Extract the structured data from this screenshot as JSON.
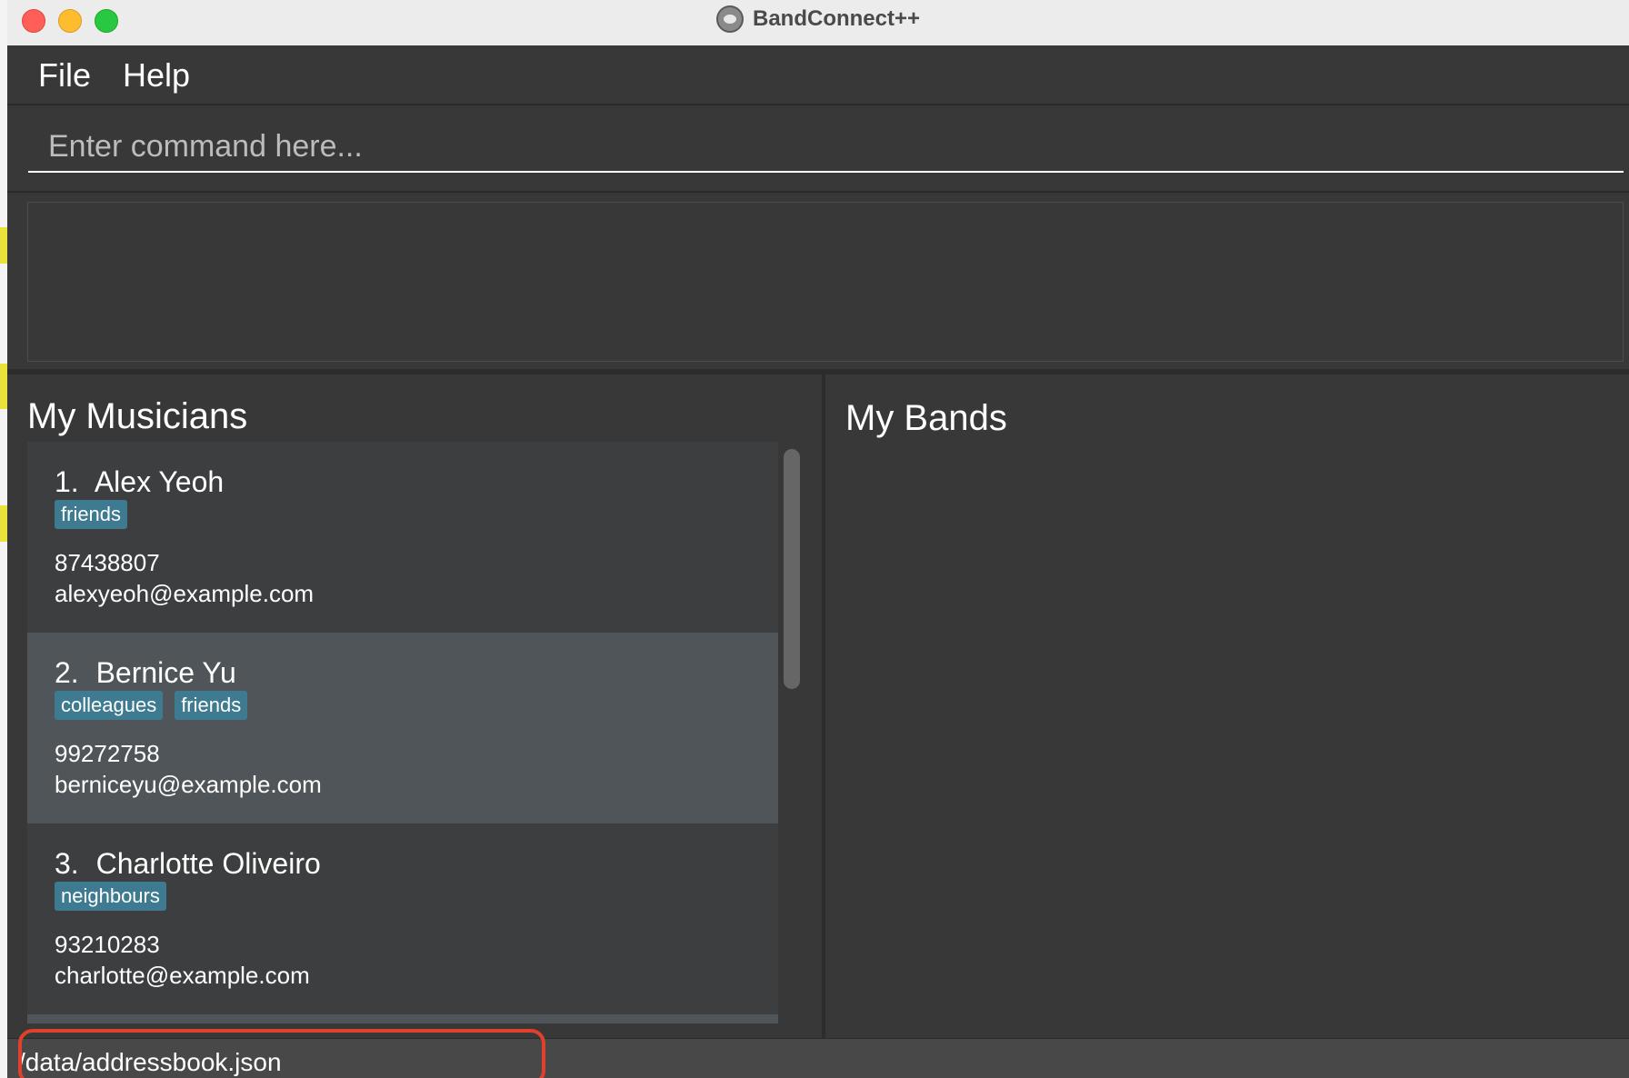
{
  "window": {
    "title": "BandConnect++"
  },
  "menu": {
    "file_label": "File",
    "help_label": "Help"
  },
  "command": {
    "placeholder": "Enter command here...",
    "value": ""
  },
  "result": {
    "text": ""
  },
  "musicians": {
    "title": "My Musicians",
    "items": [
      {
        "index": "1.",
        "name": "Alex Yeoh",
        "tags": [
          "friends"
        ],
        "phone": "87438807",
        "email": "alexyeoh@example.com",
        "selected": false
      },
      {
        "index": "2.",
        "name": "Bernice Yu",
        "tags": [
          "colleagues",
          "friends"
        ],
        "phone": "99272758",
        "email": "berniceyu@example.com",
        "selected": true
      },
      {
        "index": "3.",
        "name": "Charlotte Oliveiro",
        "tags": [
          "neighbours"
        ],
        "phone": "93210283",
        "email": "charlotte@example.com",
        "selected": false
      }
    ]
  },
  "bands": {
    "title": "My Bands"
  },
  "status": {
    "file_path": "/data/addressbook.json"
  },
  "colors": {
    "background": "#383838",
    "card": "#3c3e3f",
    "card_selected": "#4f5558",
    "tag": "#3e7b91",
    "annotation": "#e0402c"
  }
}
